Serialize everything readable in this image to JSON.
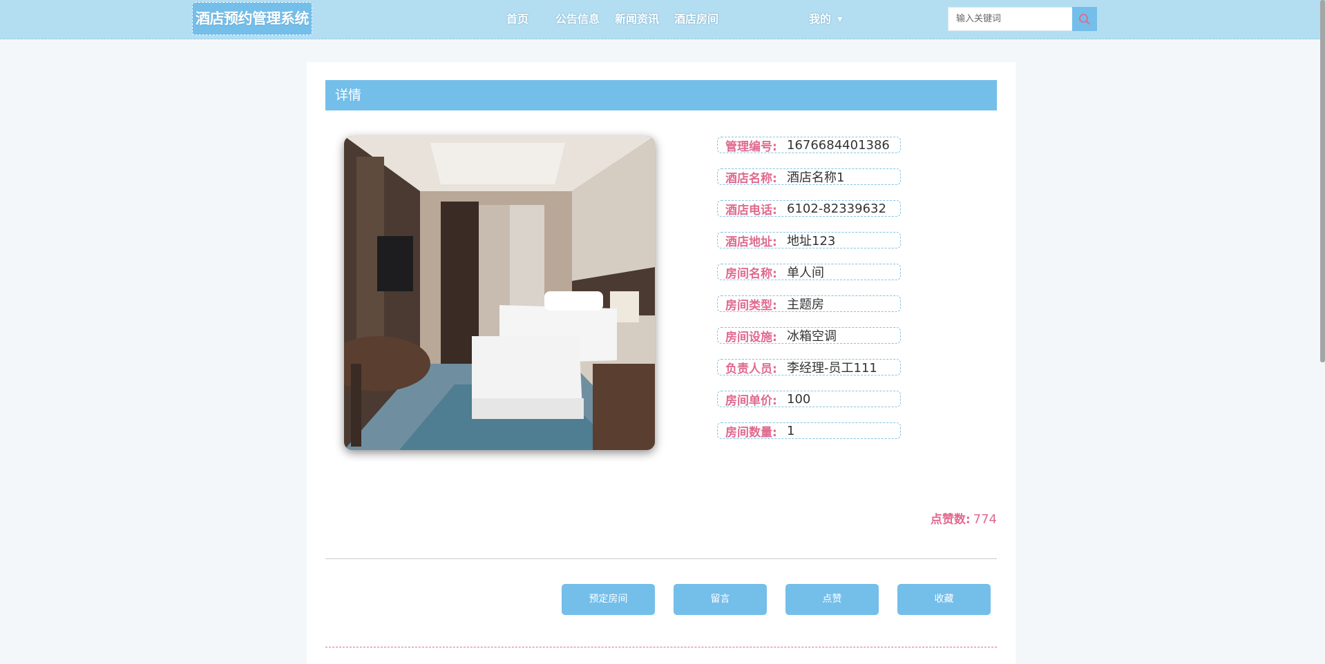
{
  "header": {
    "logo": "酒店预约管理系统",
    "nav": [
      "首页",
      "公告信息",
      "新闻资讯",
      "酒店房间"
    ],
    "user_menu": "我的",
    "search_placeholder": "输入关键词"
  },
  "detail": {
    "title": "详情",
    "fields": [
      {
        "label": "管理编号:",
        "value": "1676684401386"
      },
      {
        "label": "酒店名称:",
        "value": "酒店名称1"
      },
      {
        "label": "酒店电话:",
        "value": "6102-82339632"
      },
      {
        "label": "酒店地址:",
        "value": "地址123"
      },
      {
        "label": "房间名称:",
        "value": "单人间"
      },
      {
        "label": "房间类型:",
        "value": "主题房"
      },
      {
        "label": "房间设施:",
        "value": "冰箱空调"
      },
      {
        "label": "负责人员:",
        "value": "李经理-员工111"
      },
      {
        "label": "房间单价:",
        "value": "100"
      },
      {
        "label": "房间数量:",
        "value": "1"
      }
    ],
    "likes_label": "点赞数:",
    "likes_value": "774"
  },
  "actions": {
    "book": "预定房间",
    "message": "留言",
    "like": "点赞",
    "favorite": "收藏"
  },
  "colors": {
    "accent": "#74beea",
    "header_bg": "#b3def2",
    "label_pink": "#e06a8f"
  }
}
